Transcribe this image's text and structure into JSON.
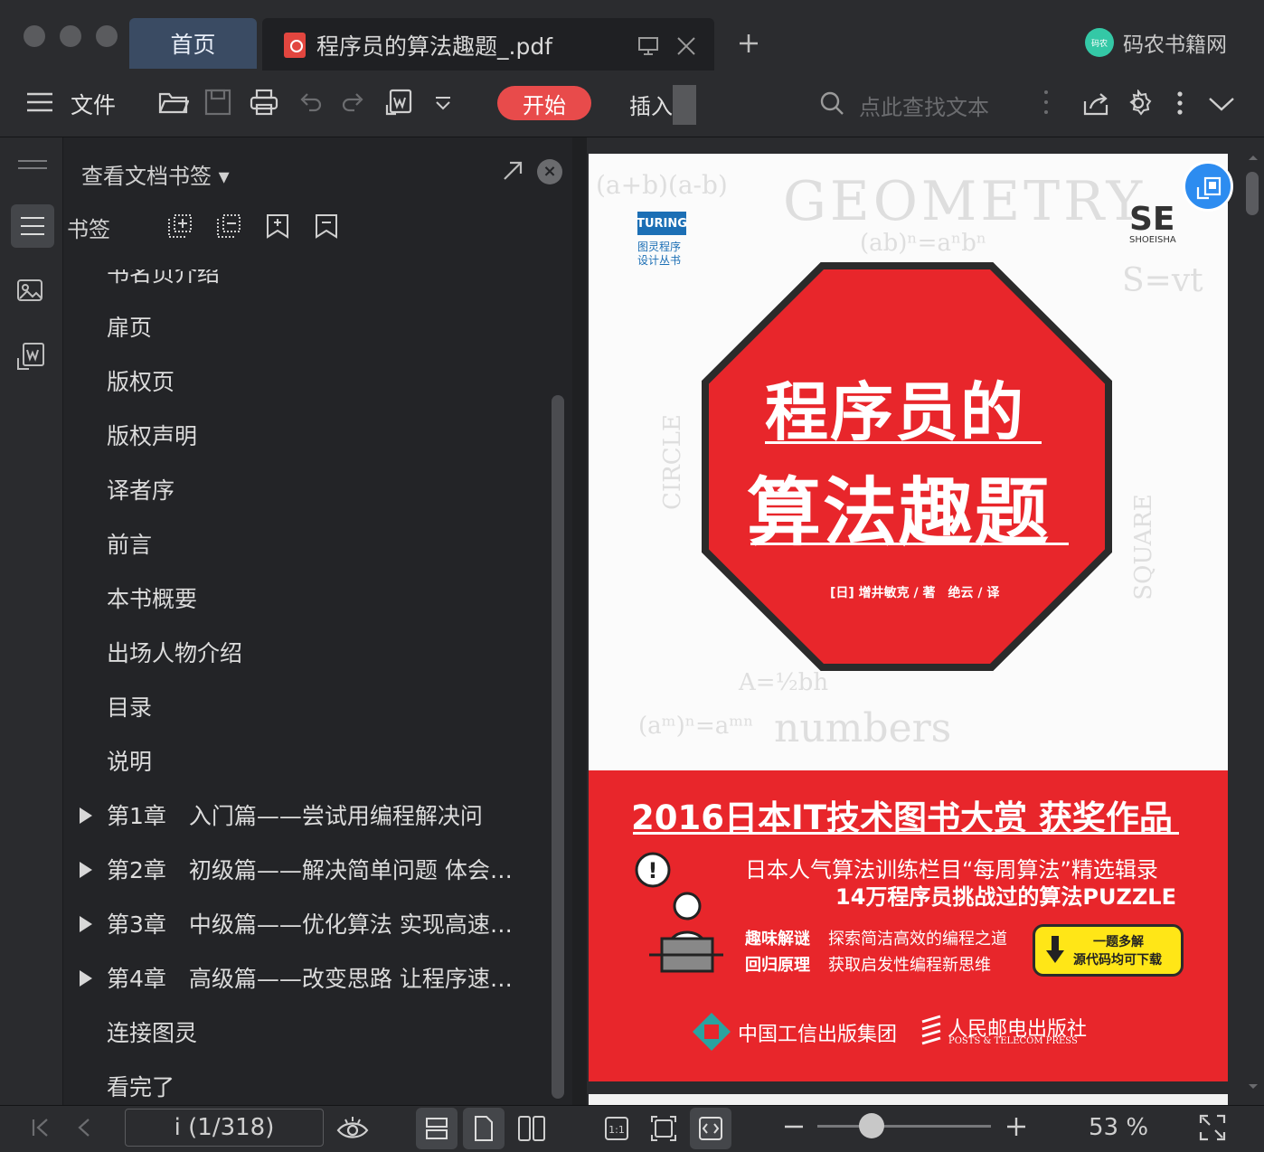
{
  "tabs": {
    "home": "首页",
    "document": "程序员的算法趣题_.pdf"
  },
  "brand": {
    "logo_text": "码农",
    "name": "码农书籍网"
  },
  "toolbar": {
    "file": "文件",
    "start": "开始",
    "insert": "插入",
    "search_placeholder": "点此查找文本"
  },
  "panel": {
    "title": "查看文档书签",
    "bookmark_label": "书签",
    "items": [
      {
        "label": "书名页介绍",
        "expandable": false
      },
      {
        "label": "扉页",
        "expandable": false
      },
      {
        "label": "版权页",
        "expandable": false
      },
      {
        "label": "版权声明",
        "expandable": false
      },
      {
        "label": "译者序",
        "expandable": false
      },
      {
        "label": "前言",
        "expandable": false
      },
      {
        "label": "本书概要",
        "expandable": false
      },
      {
        "label": "出场人物介绍",
        "expandable": false
      },
      {
        "label": "目录",
        "expandable": false
      },
      {
        "label": "说明",
        "expandable": false
      },
      {
        "label": "第1章　入门篇——尝试用编程解决问",
        "expandable": true
      },
      {
        "label": "第2章　初级篇——解决简单问题 体会…",
        "expandable": true
      },
      {
        "label": "第3章　中级篇——优化算法 实现高速…",
        "expandable": true
      },
      {
        "label": "第4章　高级篇——改变思路 让程序速…",
        "expandable": true
      },
      {
        "label": "连接图灵",
        "expandable": false
      },
      {
        "label": "看完了",
        "expandable": false
      }
    ]
  },
  "cover": {
    "series_logo": "TURING",
    "series_name_1": "图灵程序",
    "series_name_2": "设计丛书",
    "publisher_logo": "SE",
    "publisher_sub": "SHOEISHA",
    "title_line1": "程序员的",
    "title_line2": "算法趣题",
    "authors": "[日] 增井敏克 / 著　绝云 / 译",
    "award": "2016日本IT技术图书大赏 获奖作品",
    "tagline1": "日本人气算法训练栏目“每周算法”精选辑录",
    "tagline2": "14万程序员挑战过的算法PUZZLE",
    "feature1_key": "趣味解谜",
    "feature1_text": "探索简洁高效的编程之道",
    "feature2_key": "回归原理",
    "feature2_text": "获取启发性编程新思维",
    "download_line1": "一题多解",
    "download_line2": "源代码均可下载",
    "pub1": "中国工信出版集团",
    "pub2": "人民邮电出版社",
    "pub2_en": "POSTS & TELECOM PRESS",
    "sketch_words": [
      "GEOMETRY",
      "CIRCLE",
      "SQUARE",
      "numbers",
      "S=vt",
      "(ab)ⁿ=aⁿbⁿ",
      "A=½bh",
      "(aᵐ)ⁿ=aᵐⁿ",
      "(a+b)(a-b)"
    ]
  },
  "status": {
    "page_indicator": "i (1/318)",
    "zoom": "53 %",
    "zoom_level": 0.31
  },
  "colors": {
    "accent_red": "#e8262b",
    "start_button": "#e84b4b",
    "home_tab": "#3a4b63",
    "highlight_yellow": "#ffe617"
  }
}
